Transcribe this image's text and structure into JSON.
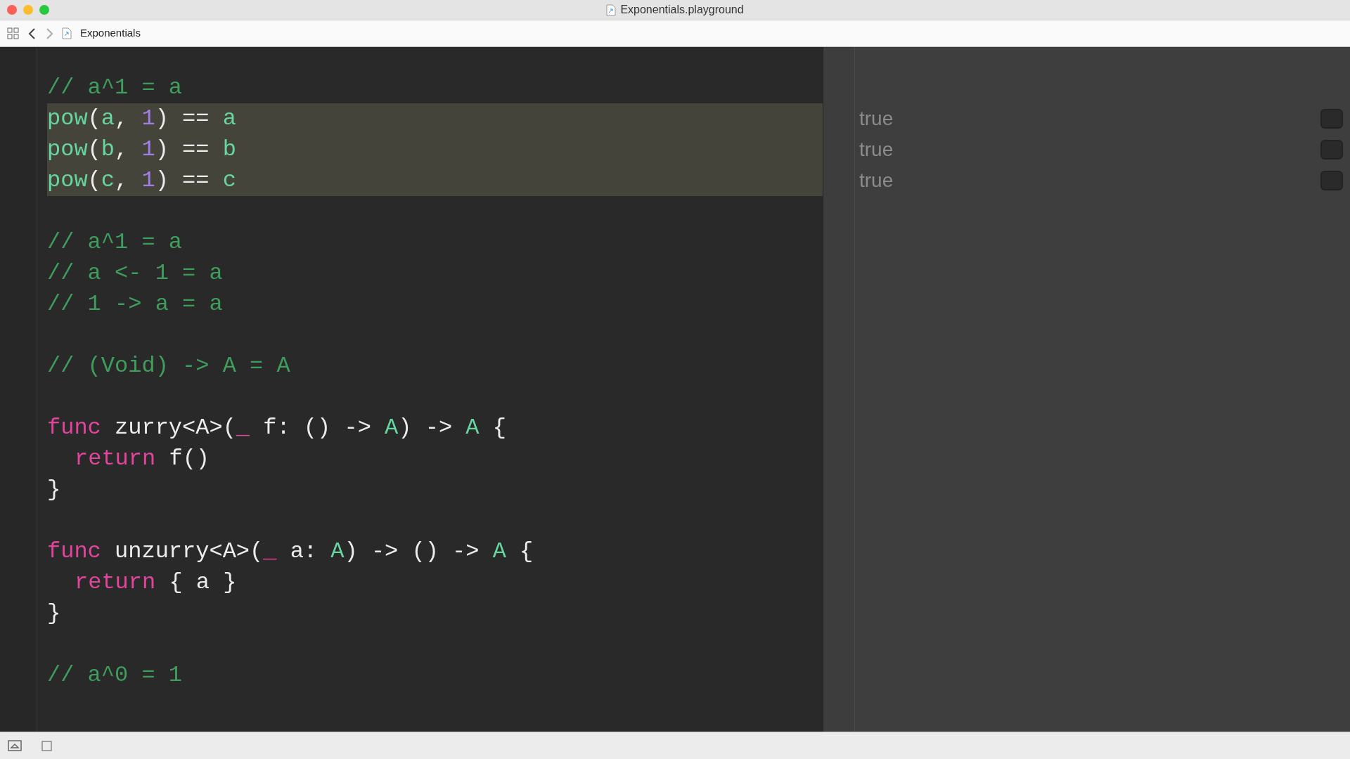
{
  "window": {
    "title": "Exponentials.playground"
  },
  "breadcrumb": {
    "label": "Exponentials"
  },
  "lines": [
    {
      "kind": "code",
      "highlighted": false,
      "tokens": [
        {
          "kind": "comment",
          "text": "// a^1 = a"
        }
      ]
    },
    {
      "kind": "code",
      "highlighted": true,
      "result": "true",
      "tokens": [
        {
          "kind": "ident",
          "text": "pow"
        },
        {
          "kind": "plain",
          "text": "("
        },
        {
          "kind": "ident",
          "text": "a"
        },
        {
          "kind": "plain",
          "text": ", "
        },
        {
          "kind": "number",
          "text": "1"
        },
        {
          "kind": "plain",
          "text": ") == "
        },
        {
          "kind": "ident",
          "text": "a"
        }
      ]
    },
    {
      "kind": "code",
      "highlighted": true,
      "result": "true",
      "tokens": [
        {
          "kind": "ident",
          "text": "pow"
        },
        {
          "kind": "plain",
          "text": "("
        },
        {
          "kind": "ident",
          "text": "b"
        },
        {
          "kind": "plain",
          "text": ", "
        },
        {
          "kind": "number",
          "text": "1"
        },
        {
          "kind": "plain",
          "text": ") == "
        },
        {
          "kind": "ident",
          "text": "b"
        }
      ]
    },
    {
      "kind": "code",
      "highlighted": true,
      "result": "true",
      "tokens": [
        {
          "kind": "ident",
          "text": "pow"
        },
        {
          "kind": "plain",
          "text": "("
        },
        {
          "kind": "ident",
          "text": "c"
        },
        {
          "kind": "plain",
          "text": ", "
        },
        {
          "kind": "number",
          "text": "1"
        },
        {
          "kind": "plain",
          "text": ") == "
        },
        {
          "kind": "ident",
          "text": "c"
        }
      ]
    },
    {
      "kind": "blank"
    },
    {
      "kind": "code",
      "highlighted": false,
      "tokens": [
        {
          "kind": "comment",
          "text": "// a^1 = a"
        }
      ]
    },
    {
      "kind": "code",
      "highlighted": false,
      "tokens": [
        {
          "kind": "comment",
          "text": "// a <- 1 = a"
        }
      ]
    },
    {
      "kind": "code",
      "highlighted": false,
      "tokens": [
        {
          "kind": "comment",
          "text": "// 1 -> a = a"
        }
      ]
    },
    {
      "kind": "blank"
    },
    {
      "kind": "code",
      "highlighted": false,
      "tokens": [
        {
          "kind": "comment",
          "text": "// (Void) -> A = A"
        }
      ]
    },
    {
      "kind": "blank"
    },
    {
      "kind": "code",
      "highlighted": false,
      "tokens": [
        {
          "kind": "keyword",
          "text": "func"
        },
        {
          "kind": "plain",
          "text": " zurry<A>("
        },
        {
          "kind": "keyword",
          "text": "_"
        },
        {
          "kind": "plain",
          "text": " f: () -> "
        },
        {
          "kind": "ident",
          "text": "A"
        },
        {
          "kind": "plain",
          "text": ") -> "
        },
        {
          "kind": "ident",
          "text": "A"
        },
        {
          "kind": "plain",
          "text": " {"
        }
      ]
    },
    {
      "kind": "code",
      "highlighted": false,
      "indented": true,
      "tokens": [
        {
          "kind": "keyword",
          "text": "return"
        },
        {
          "kind": "plain",
          "text": " f()"
        }
      ]
    },
    {
      "kind": "code",
      "highlighted": false,
      "tokens": [
        {
          "kind": "plain",
          "text": "}"
        }
      ]
    },
    {
      "kind": "blank"
    },
    {
      "kind": "code",
      "highlighted": false,
      "tokens": [
        {
          "kind": "keyword",
          "text": "func"
        },
        {
          "kind": "plain",
          "text": " unzurry<A>("
        },
        {
          "kind": "keyword",
          "text": "_"
        },
        {
          "kind": "plain",
          "text": " a: "
        },
        {
          "kind": "ident",
          "text": "A"
        },
        {
          "kind": "plain",
          "text": ") -> () -> "
        },
        {
          "kind": "ident",
          "text": "A"
        },
        {
          "kind": "plain",
          "text": " {"
        }
      ]
    },
    {
      "kind": "code",
      "highlighted": false,
      "indented": true,
      "tokens": [
        {
          "kind": "keyword",
          "text": "return"
        },
        {
          "kind": "plain",
          "text": " { a }"
        }
      ]
    },
    {
      "kind": "code",
      "highlighted": false,
      "tokens": [
        {
          "kind": "plain",
          "text": "}"
        }
      ]
    },
    {
      "kind": "blank"
    },
    {
      "kind": "code",
      "highlighted": false,
      "tokens": [
        {
          "kind": "comment",
          "text": "// a^0 = 1"
        }
      ]
    }
  ]
}
